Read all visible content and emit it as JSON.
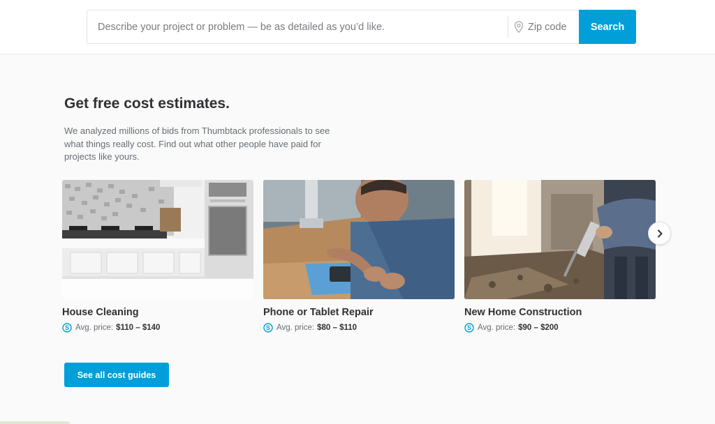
{
  "search": {
    "placeholder": "Describe your project or problem — be as detailed as you’d like.",
    "zip_placeholder": "Zip code",
    "button_label": "Search"
  },
  "section": {
    "heading": "Get free cost estimates.",
    "description": "We analyzed millions of bids from Thumbtack professionals to see what things really cost. Find out what other people have paid for projects like yours."
  },
  "cards": [
    {
      "title": "House Cleaning",
      "price_label": "Avg. price:",
      "price_range": "$110 – $140"
    },
    {
      "title": "Phone or Tablet Repair",
      "price_label": "Avg. price:",
      "price_range": "$80 – $110"
    },
    {
      "title": "New Home Construction",
      "price_label": "Avg. price:",
      "price_range": "$90 – $200"
    }
  ],
  "see_all_button": "See all cost guides",
  "icons": {
    "location": "map-pin-icon",
    "price": "dollar-circle-icon",
    "next": "chevron-right-icon"
  },
  "colors": {
    "accent": "#009fd9",
    "heading": "#2f3033",
    "body_text": "#676d73",
    "page_background": "#fafafa"
  }
}
